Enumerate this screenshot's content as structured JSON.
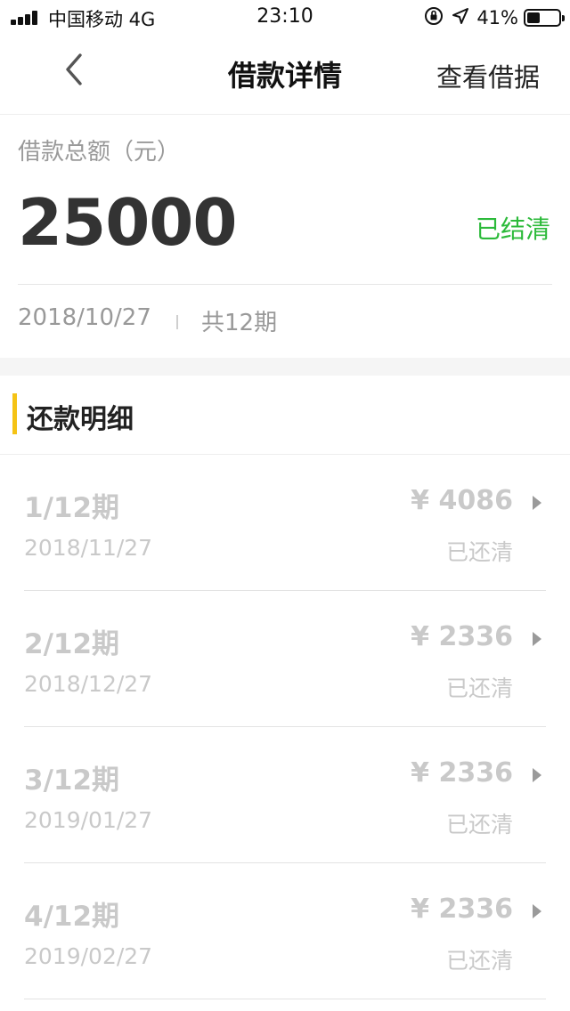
{
  "status_bar": {
    "carrier": "中国移动 4G",
    "time": "23:10",
    "battery_pct": "41%",
    "battery_level": 0.41,
    "icons": [
      "signal-icon",
      "orientation-lock-icon",
      "location-icon",
      "battery-icon"
    ]
  },
  "nav": {
    "title": "借款详情",
    "action": "查看借据",
    "back_icon": "chevron-left-icon"
  },
  "summary": {
    "label": "借款总额（元）",
    "amount": "25000",
    "status": "已结清",
    "date": "2018/10/27",
    "periods": "共12期"
  },
  "section": {
    "title": "还款明细"
  },
  "repayments": [
    {
      "period": "1/12期",
      "date": "2018/11/27",
      "amount": "¥ 4086",
      "status": "已还清"
    },
    {
      "period": "2/12期",
      "date": "2018/12/27",
      "amount": "¥ 2336",
      "status": "已还清"
    },
    {
      "period": "3/12期",
      "date": "2019/01/27",
      "amount": "¥ 2336",
      "status": "已还清"
    },
    {
      "period": "4/12期",
      "date": "2019/02/27",
      "amount": "¥ 2336",
      "status": "已还清"
    }
  ],
  "colors": {
    "accent_bar": "#f5c315",
    "settled_green": "#2cba3a",
    "muted_text": "#c9c9c9"
  }
}
